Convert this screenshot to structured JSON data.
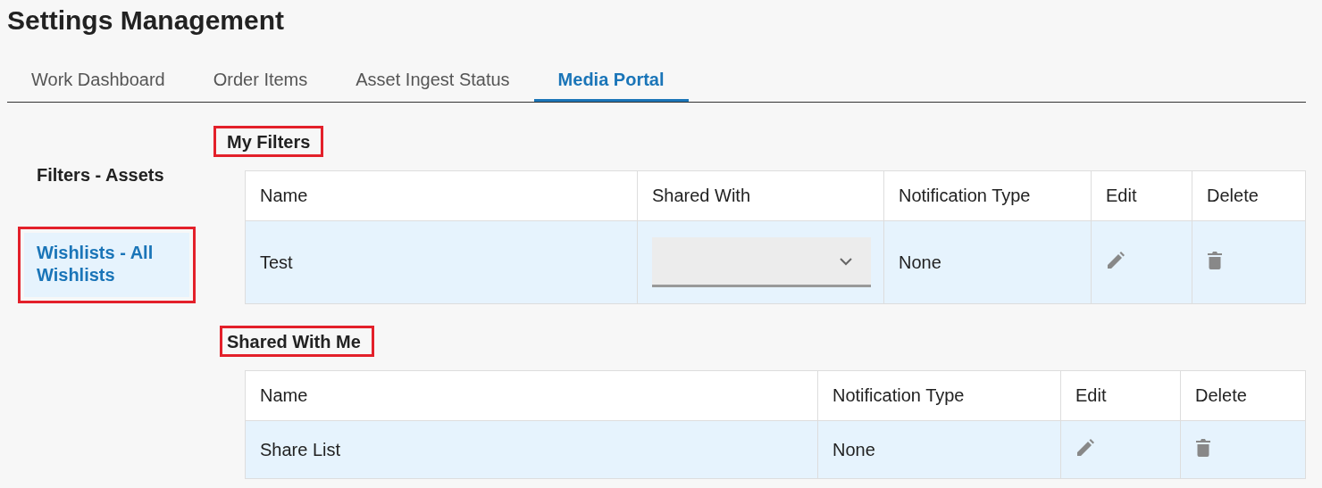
{
  "title": "Settings Management",
  "tabs": [
    {
      "label": "Work Dashboard",
      "selected": false
    },
    {
      "label": "Order Items",
      "selected": false
    },
    {
      "label": "Asset Ingest Status",
      "selected": false
    },
    {
      "label": "Media Portal",
      "selected": true
    }
  ],
  "sidebar": {
    "items": [
      {
        "label": "Filters - Assets",
        "selected": false,
        "highlighted": false
      },
      {
        "label": "Wishlists - All Wishlists",
        "selected": true,
        "highlighted": true
      }
    ]
  },
  "sections": [
    {
      "title": "My Filters",
      "highlighted": true,
      "columns": [
        "Name",
        "Shared With",
        "Notification Type",
        "Edit",
        "Delete"
      ],
      "rows": [
        {
          "cells": [
            {
              "kind": "text",
              "text": "Test"
            },
            {
              "kind": "select"
            },
            {
              "kind": "text",
              "text": "None"
            },
            {
              "kind": "edit"
            },
            {
              "kind": "delete"
            }
          ]
        }
      ]
    },
    {
      "title": "Shared With Me",
      "highlighted": true,
      "columns": [
        "Name",
        "Notification Type",
        "Edit",
        "Delete"
      ],
      "rows": [
        {
          "cells": [
            {
              "kind": "text",
              "text": "Share List"
            },
            {
              "kind": "text",
              "text": "None"
            },
            {
              "kind": "edit"
            },
            {
              "kind": "delete"
            }
          ]
        }
      ]
    }
  ]
}
